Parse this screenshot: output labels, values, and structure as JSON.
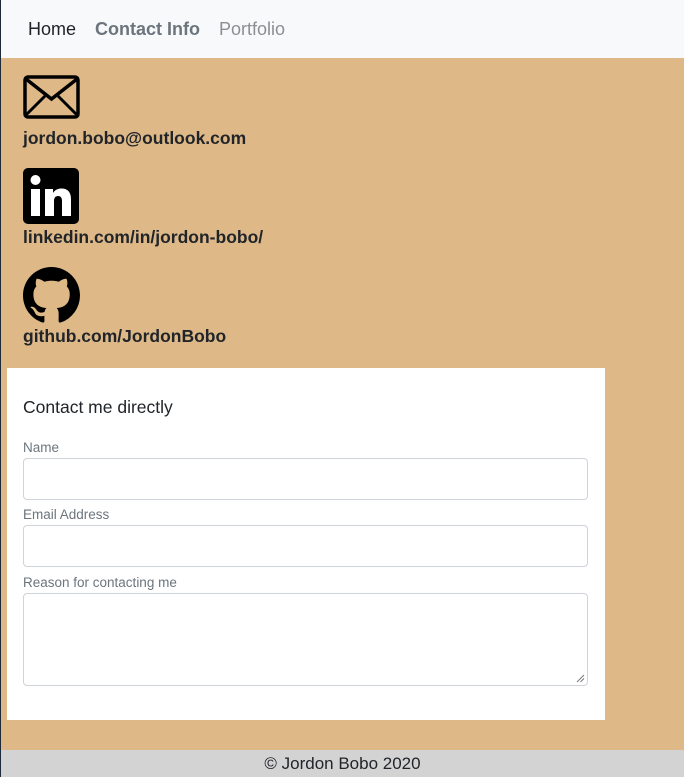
{
  "nav": {
    "home": "Home",
    "contact": "Contact Info",
    "portfolio": "Portfolio"
  },
  "contacts": {
    "email": {
      "icon": "envelope-icon",
      "text": "jordon.bobo@outlook.com"
    },
    "linkedin": {
      "icon": "linkedin-icon",
      "text": "linkedin.com/in/jordon-bobo/"
    },
    "github": {
      "icon": "github-icon",
      "text": "github.com/JordonBobo"
    }
  },
  "form": {
    "title": "Contact me directly",
    "name_label": "Name",
    "name_value": "",
    "email_label": "Email Address",
    "email_value": "",
    "reason_label": "Reason for contacting me",
    "reason_value": ""
  },
  "footer": {
    "text": "© Jordon Bobo 2020"
  },
  "colors": {
    "page_background": "#deb887",
    "navbar_background": "#f8f9fa",
    "footer_background": "#d3d3d3",
    "form_background": "#ffffff"
  }
}
